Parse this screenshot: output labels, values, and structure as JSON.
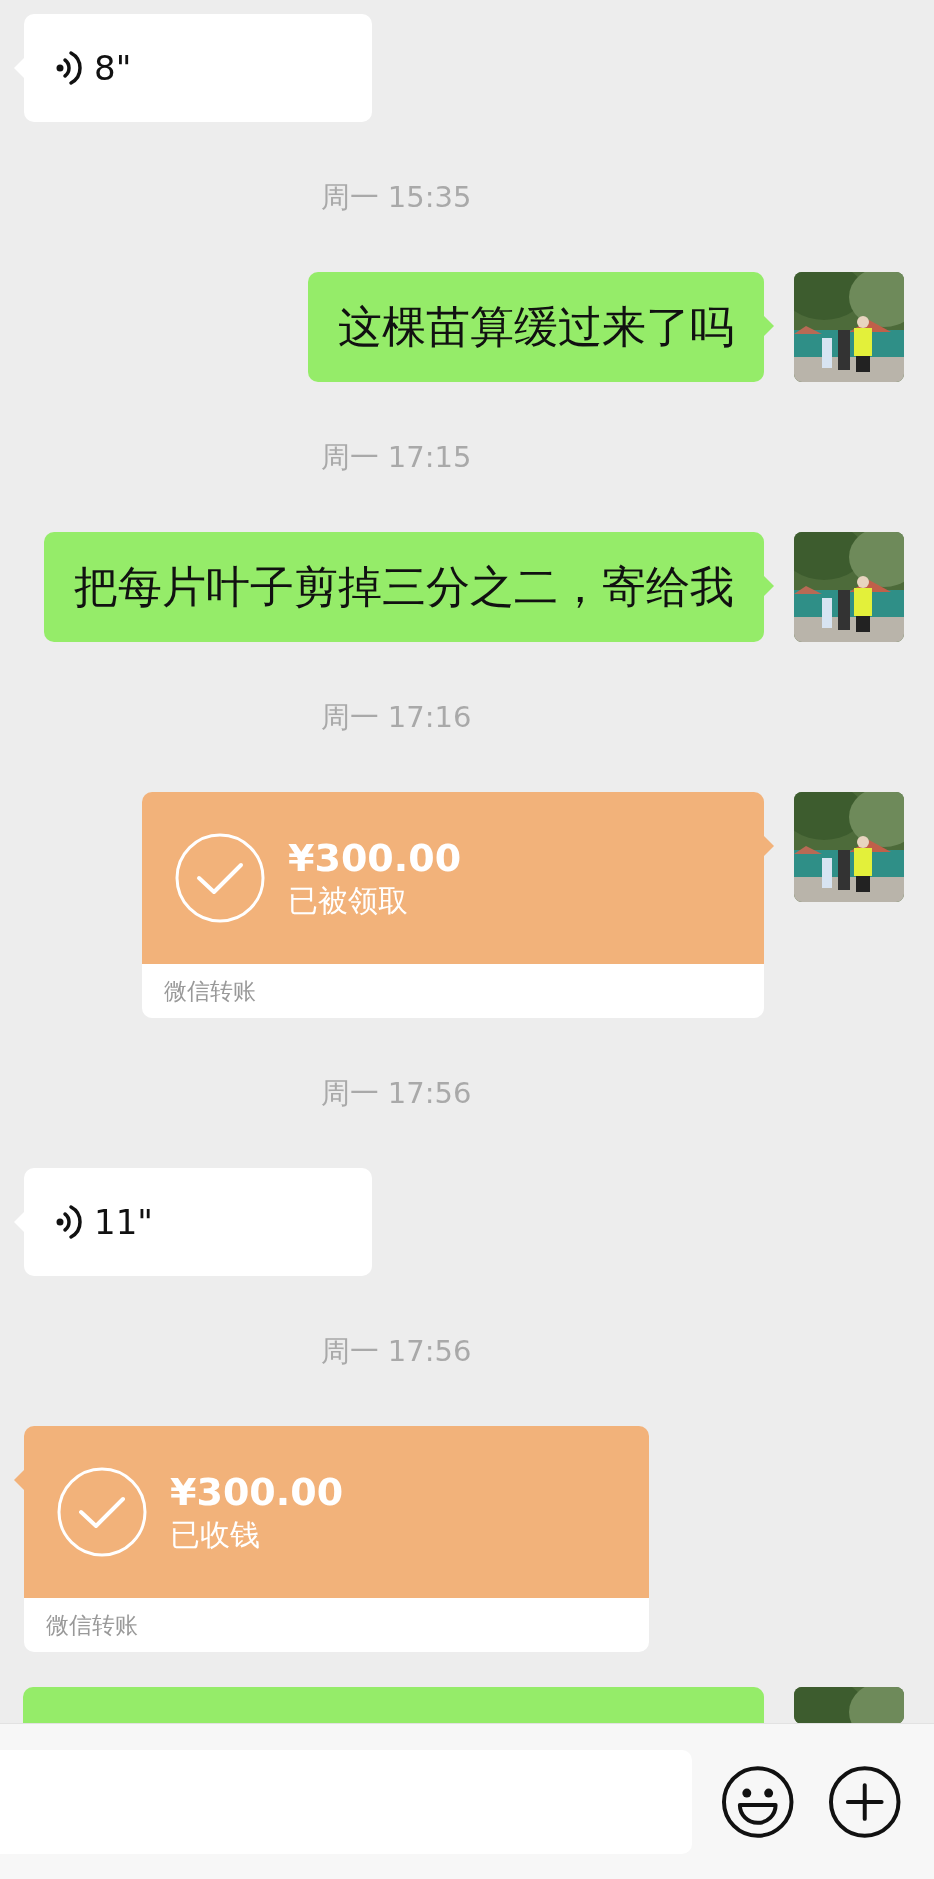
{
  "messages": [
    {
      "kind": "voice",
      "outgoing": false,
      "duration": "8\""
    },
    {
      "kind": "time",
      "text": "周一 15:35"
    },
    {
      "kind": "text",
      "outgoing": true,
      "text": "这棵苗算缓过来了吗"
    },
    {
      "kind": "time",
      "text": "周一 17:15"
    },
    {
      "kind": "text",
      "outgoing": true,
      "text": "把每片叶子剪掉三分之二，寄给我"
    },
    {
      "kind": "time",
      "text": "周一 17:16"
    },
    {
      "kind": "transfer",
      "outgoing": true,
      "amount": "¥300.00",
      "status": "已被领取",
      "label": "微信转账"
    },
    {
      "kind": "time",
      "text": "周一 17:56"
    },
    {
      "kind": "voice",
      "outgoing": false,
      "duration": "11\""
    },
    {
      "kind": "time",
      "text": "周一 17:56"
    },
    {
      "kind": "transfer",
      "outgoing": false,
      "amount": "¥300.00",
      "status": "已收钱",
      "label": "微信转账"
    },
    {
      "kind": "text",
      "outgoing": true
    }
  ]
}
